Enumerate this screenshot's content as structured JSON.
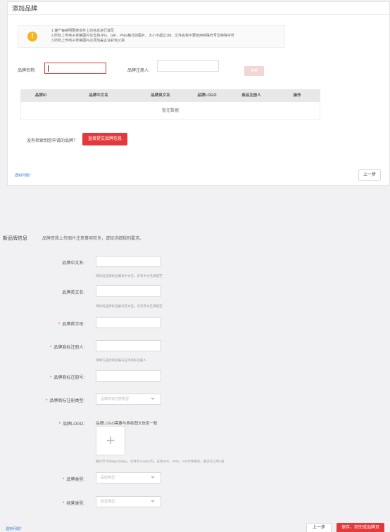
{
  "panel": {
    "title": "添加品牌"
  },
  "notice": {
    "icon": "exclamation-icon",
    "lines": [
      "1.遵产每被明要搜该件上的信息进行填写",
      "2.所有上传电子表格图片仅支持JPG、GIF、PNG格式的图片，大小不超过1M，文件名称不要使用特殊符号及特殊字符",
      "3.所有上传电子表格图片必须加盖企业彩色公章"
    ]
  },
  "search": {
    "brand_name_label": "品牌名称:",
    "registrant_label": "品牌注册人:",
    "search_button": "搜索"
  },
  "table": {
    "columns": [
      "品牌ID",
      "品牌中文名",
      "品牌英文名",
      "品牌LOGO",
      "商品注册人",
      "操作"
    ],
    "empty_text": "暂无数据"
  },
  "noresult": {
    "text": "没有检索到您申请的品牌？",
    "button": "直接提交品牌信息"
  },
  "footer_top": {
    "help_link": "遇到问题？",
    "prev_button": "上一步"
  },
  "new_brand": {
    "section_title": "新品牌信息",
    "section_subtitle": "品牌资质上传图片注意事项较多，请知详细规则要求。",
    "fields": {
      "cn_name_label": "品牌中文名:",
      "cn_name_hint": "商标局品牌标注编号中文名，没有中文名请留空",
      "en_name_label": "品牌英文名:",
      "en_name_hint": "商标局品牌标注编号英文名，没有英文名请留空",
      "initial_label": "品牌首字母:",
      "registrant_label": "品牌商标注册人:",
      "registrant_hint": "请填写品牌商标编号证书商标注册人",
      "reg_no_label": "品牌商标注册号:",
      "reg_type_label": "品牌商标注册类型:",
      "reg_type_placeholder": "品牌商标注册类型",
      "logo_label": "品牌LOGO:",
      "logo_note": "品牌LOGO需要与商标图文信息一致",
      "logo_hint": "图片尺寸400px*200px，文件大小1M以内，支持JPG、PNG、GIF文件格式，最多可上传1张",
      "brand_type_label": "品牌类型:",
      "brand_type_placeholder": "品牌类型",
      "biz_type_label": "经营类型:",
      "biz_type_placeholder": "经营类型"
    },
    "upload_plus": "+"
  },
  "footer_bottom": {
    "help_link": "遇到问题？",
    "prev_button": "上一步",
    "submit_button": "保存，到完成品牌页"
  },
  "colors": {
    "accent": "#e4393c",
    "notice_icon": "#f4b41a"
  }
}
